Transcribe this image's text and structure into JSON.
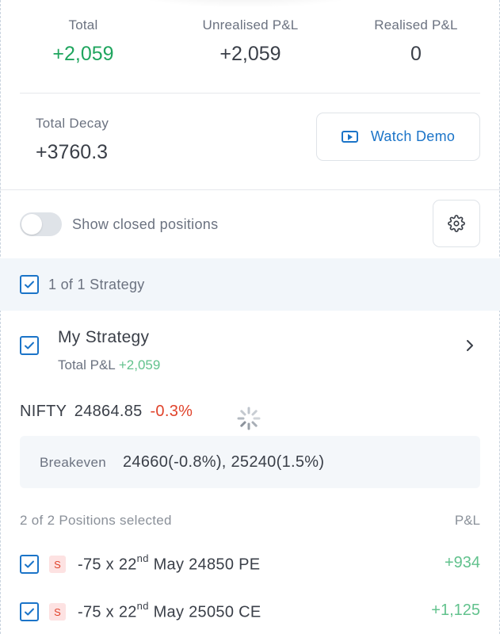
{
  "summary": {
    "total_label": "Total",
    "total_value": "+2,059",
    "unrealised_label": "Unrealised P&L",
    "unrealised_value": "+2,059",
    "realised_label": "Realised P&L",
    "realised_value": "0"
  },
  "decay": {
    "label": "Total Decay",
    "value": "+3760.3"
  },
  "demo_button": {
    "label": "Watch Demo",
    "icon": "play-video-icon"
  },
  "controls": {
    "show_closed_label": "Show closed positions",
    "show_closed_on": false,
    "settings_icon": "gear-icon"
  },
  "strategy_bar": {
    "count_label": "1 of 1 Strategy",
    "checked": true
  },
  "strategy": {
    "name": "My Strategy",
    "pnl_label": "Total P&L",
    "pnl_value": "+2,059",
    "checked": true
  },
  "underlying": {
    "symbol": "NIFTY",
    "price": "24864.85",
    "change": "-0.3%"
  },
  "breakeven": {
    "label": "Breakeven",
    "value": "24660(-0.8%), 25240(1.5%)"
  },
  "positions": {
    "header": "2 of 2 Positions selected",
    "pnl_header": "P&L",
    "items": [
      {
        "side": "S",
        "qty": "-75 x 22",
        "suffix": "nd",
        "rest": " May 24850 PE",
        "pnl": "+934"
      },
      {
        "side": "S",
        "qty": "-75 x 22",
        "suffix": "nd",
        "rest": " May 25050 CE",
        "pnl": "+1,125"
      }
    ]
  },
  "colors": {
    "accent": "#1b74c8",
    "profit": "#1fa55e",
    "loss": "#e0432b"
  }
}
